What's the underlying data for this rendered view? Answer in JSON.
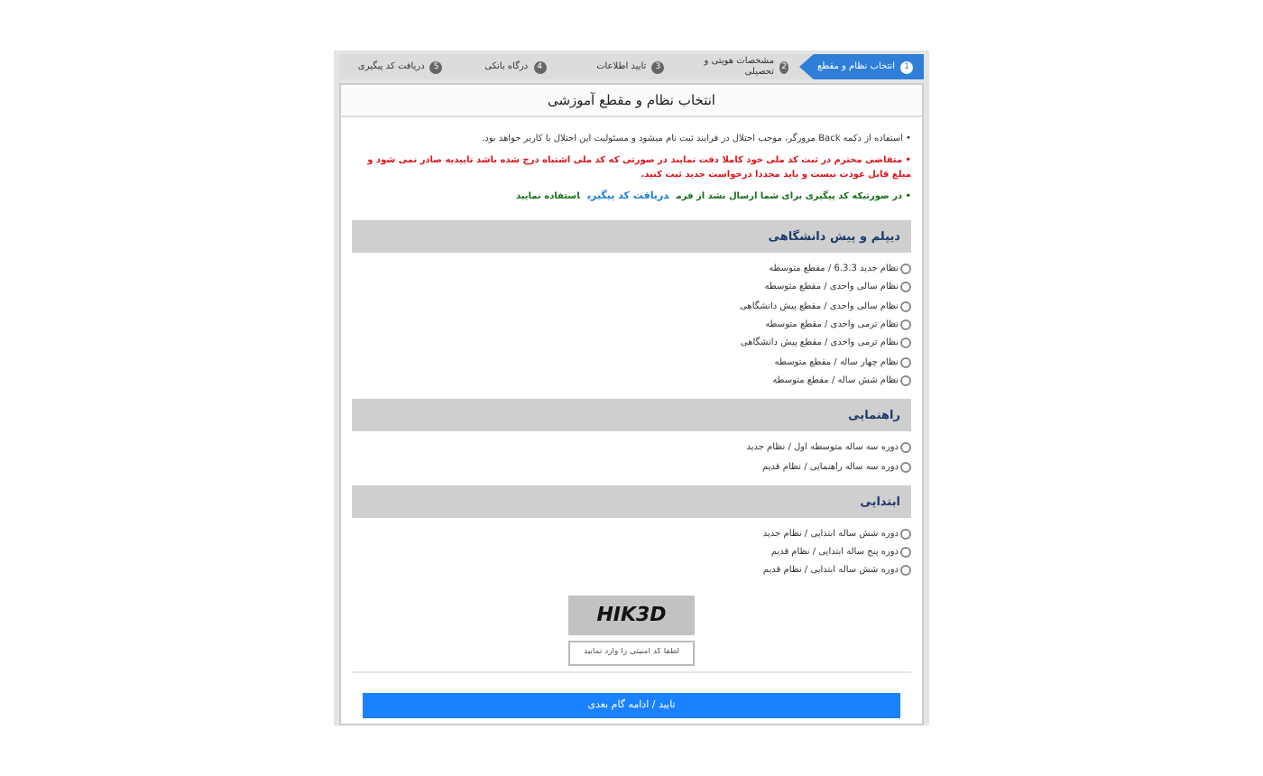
{
  "steps": [
    {
      "number": "1",
      "label": "انتخاب نظام و مقطع",
      "selected": true
    },
    {
      "number": "2",
      "label": "مشخصات هویتی و تحصیلی",
      "selected": false
    },
    {
      "number": "3",
      "label": "تایید اطلاعات",
      "selected": false
    },
    {
      "number": "4",
      "label": "درگاه بانکی",
      "selected": false
    },
    {
      "number": "5",
      "label": "دریافت کد پیگیری",
      "selected": false
    }
  ],
  "title": "انتخاب نظام و مقطع آموزشی",
  "notes": [
    {
      "kind": "plain",
      "text": "• استفاده از دکمه Back مرورگر، موجب اختلال در فرایند ثبت نام میشود و مسئولیت این اختلال با کاربر خواهد بود."
    },
    {
      "kind": "warning",
      "text": "• متقاضی محترم در ثبت کد ملی خود کاملا دقت نمایند در صورتی که کد ملی اشتباه درج شده باشد تاییدیه صادر نمی شود و مبلغ قابل عودت نیست و باید مجددا درخواست جدید ثبت کنید."
    },
    {
      "kind": "link",
      "text": "• در صورتیکه کد پیگیری برای شما ارسال نشد از فرم",
      "link": "دریافت کد پیگیری",
      "after": "استفاده نمایید"
    }
  ],
  "sections": [
    {
      "title": "دیپلم و پیش دانشگاهی",
      "options": [
        {
          "label": "نظام جدید 6.3.3 / مقطع متوسطه",
          "selected": false
        },
        {
          "label": "نظام سالی واحدی / مقطع متوسطه",
          "selected": false
        },
        {
          "label": "نظام سالی واحدی / مقطع پیش دانشگاهی",
          "selected": false
        },
        {
          "label": "نظام ترمی واحدی / مقطع متوسطه",
          "selected": false
        },
        {
          "label": "نظام ترمی واحدی / مقطع پیش دانشگاهی",
          "selected": false
        },
        {
          "label": "نظام چهار ساله / مقطع متوسطه",
          "selected": false
        },
        {
          "label": "نظام شش ساله / مقطع متوسطه",
          "selected": false
        }
      ]
    },
    {
      "title": "راهنمایی",
      "options": [
        {
          "label": "دوره سه ساله متوسطه اول / نظام جدید",
          "selected": false
        },
        {
          "label": "دوره سه ساله راهنمایی / نظام قدیم",
          "selected": false
        }
      ]
    },
    {
      "title": "ابتدایی",
      "options": [
        {
          "label": "دوره شش ساله ابتدایی / نظام جدید",
          "selected": false
        },
        {
          "label": "دوره پنج ساله ابتدایی / نظام قدیم",
          "selected": false
        },
        {
          "label": "دوره شش ساله ابتدایی / نظام قدیم",
          "selected": false
        }
      ]
    }
  ],
  "captcha": {
    "code": "HIK3D",
    "placeholder": "لطفا کد امنیتی را وارد نمایید"
  },
  "submit": "تایید / ادامه گام بعدی"
}
